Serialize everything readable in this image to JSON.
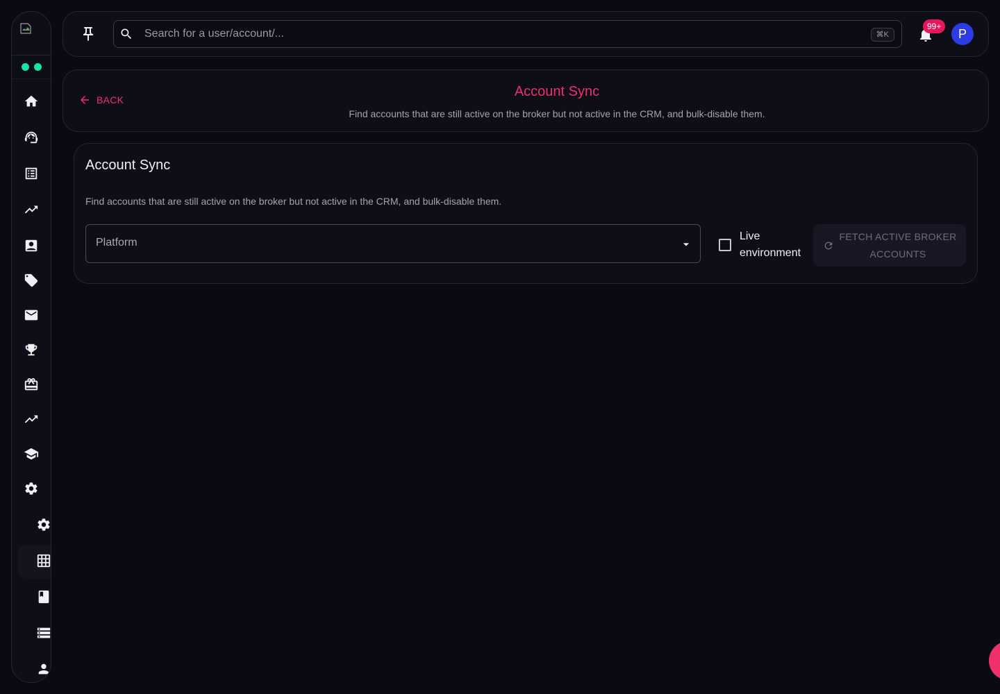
{
  "topbar": {
    "search_placeholder": "Search for a user/account/...",
    "shortcut": "⌘K",
    "notifications_badge": "99+",
    "avatar_initial": "P"
  },
  "sidebar": {
    "status_dots_color": "#17e3a8",
    "items": [
      {
        "icon": "home-icon"
      },
      {
        "icon": "support-agent-icon"
      },
      {
        "icon": "list-alt-icon"
      },
      {
        "icon": "trending-up-icon"
      },
      {
        "icon": "contact-card-icon"
      },
      {
        "icon": "tag-icon"
      },
      {
        "icon": "mail-icon"
      },
      {
        "icon": "trophy-icon"
      },
      {
        "icon": "gift-card-icon"
      },
      {
        "icon": "trending-up-icon"
      },
      {
        "icon": "school-icon"
      },
      {
        "icon": "settings-icon"
      }
    ],
    "sub_items": [
      {
        "icon": "settings-icon"
      },
      {
        "icon": "grid-table-icon",
        "active": true
      },
      {
        "icon": "book-icon"
      },
      {
        "icon": "storage-list-icon"
      },
      {
        "icon": "person-icon"
      }
    ]
  },
  "header": {
    "back_label": "BACK",
    "title": "Account Sync",
    "subtitle": "Find accounts that are still active on the broker but not active in the CRM, and bulk-disable them."
  },
  "card": {
    "title": "Account Sync",
    "description": "Find accounts that are still active on the broker but not active in the CRM, and bulk-disable them.",
    "platform_placeholder": "Platform",
    "live_env_label": "Live environment",
    "live_env_checked": false,
    "fetch_button_label": "FETCH ACTIVE BROKER ACCOUNTS",
    "fetch_button_disabled": true
  },
  "colors": {
    "accent": "#f0306b",
    "avatar": "#2d3be3",
    "badge": "#e8175d",
    "background": "#0a0a12"
  }
}
